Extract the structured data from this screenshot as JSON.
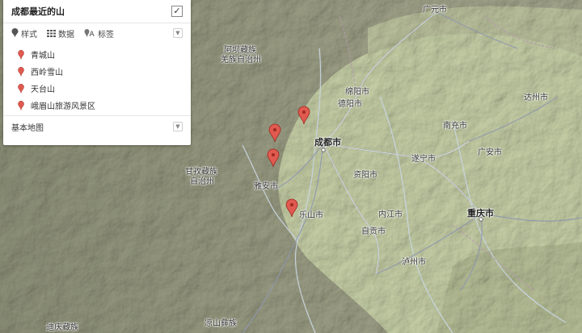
{
  "panel": {
    "title": "成都最近的山",
    "tools": {
      "style": "样式",
      "data": "数据",
      "label": "标签"
    },
    "items": [
      {
        "name": "青城山"
      },
      {
        "name": "西岭雪山"
      },
      {
        "name": "天台山"
      },
      {
        "name": "峨眉山旅游风景区"
      }
    ],
    "basemap": "基本地图"
  },
  "colors": {
    "marker": "#e05a50",
    "marker_stroke": "#9e2a20"
  },
  "map_labels": {
    "guangyuan": "广元市",
    "aba_1": "阿坝藏族",
    "aba_2": "羌族自治州",
    "mianyang": "绵阳市",
    "deyang": "德阳市",
    "dazhou": "达州市",
    "nanchong": "南充市",
    "guangan": "广安市",
    "suining": "遂宁市",
    "chengdu": "成都市",
    "ganzi_1": "甘孜藏族",
    "ganzi_2": "自治州",
    "yaan": "雅安市",
    "ziyang": "资阳市",
    "leshan": "乐山市",
    "neijiang": "内江市",
    "chongqing": "重庆市",
    "zigong": "自贡市",
    "luzhou": "泸州市",
    "liangshan": "凉山彝族",
    "diqing": "迪庆藏族"
  }
}
